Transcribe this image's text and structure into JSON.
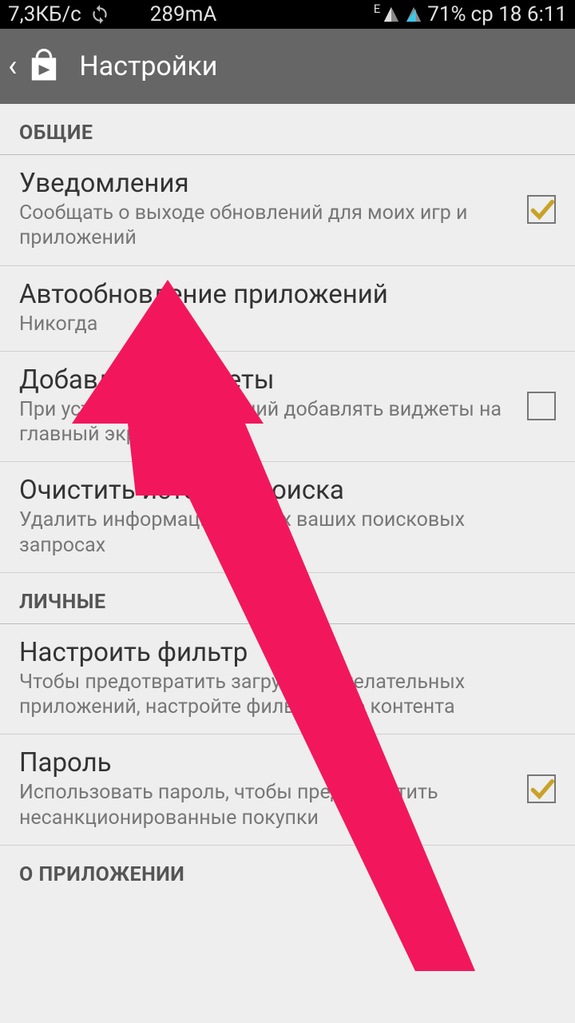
{
  "status": {
    "speed": "7,3КБ/с",
    "current": "289mA",
    "edge": "E",
    "battery": "71%",
    "date": "ср 18 6:11"
  },
  "header": {
    "title": "Настройки"
  },
  "sections": {
    "general": "ОБЩИЕ",
    "personal": "ЛИЧНЫЕ",
    "about": "О ПРИЛОЖЕНИИ"
  },
  "settings": {
    "notifications": {
      "title": "Уведомления",
      "sub": "Сообщать о выходе обновлений для моих игр и приложений"
    },
    "autoupdate": {
      "title": "Автообновление приложений",
      "sub": "Никогда"
    },
    "widgets": {
      "title": "Добавлять виджеты",
      "sub": "При установке приложений добавлять виджеты на главный экран"
    },
    "clearsearch": {
      "title": "Очистить историю поиска",
      "sub": "Удалить информацию о всех ваших поисковых запросах"
    },
    "filter": {
      "title": "Настроить фильтр",
      "sub": "Чтобы предотвратить загрузку нежелательных приложений, настройте фильтрацию контента"
    },
    "password": {
      "title": "Пароль",
      "sub": "Использовать пароль, чтобы предотвратить несанкционированные покупки"
    }
  }
}
